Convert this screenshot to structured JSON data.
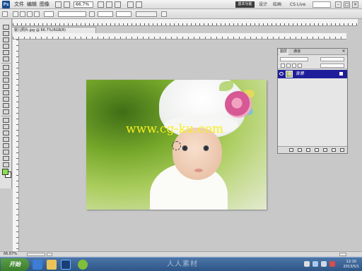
{
  "menu": {
    "app_icon": "Ps",
    "left_items": [
      "文件",
      "编辑",
      "图像"
    ],
    "zoom_value": "66.7%",
    "workspace_label": "基本功能",
    "right_items": [
      "设计",
      "绘画",
      "CS Live"
    ]
  },
  "document": {
    "tab_title": "婴儿照片.jpg @ 66.7%(RGB/8)"
  },
  "canvas": {
    "watermark_text": "www.cg-ku.com"
  },
  "layers_panel": {
    "tabs": [
      "图层",
      "通道"
    ],
    "layer_name": "背景",
    "close_symbol": "×"
  },
  "status": {
    "zoom": "66.67%"
  },
  "taskbar": {
    "start_label": "开始",
    "overlay_text": "人人素材",
    "clock_time": "12:10",
    "clock_date": "2013/5/1"
  },
  "colors": {
    "foreground": "#88e24e",
    "background": "#ffffff",
    "layer_selection": "#1f1e9a",
    "watermark": "#f6f01a"
  },
  "icons": {
    "toolbox": [
      "move-icon",
      "marquee-icon",
      "lasso-icon",
      "quick-select-icon",
      "crop-icon",
      "eyedropper-icon",
      "healing-icon",
      "brush-icon",
      "clone-stamp-icon",
      "history-brush-icon",
      "eraser-icon",
      "gradient-icon",
      "blur-icon",
      "dodge-icon",
      "pen-icon",
      "type-icon",
      "path-select-icon",
      "shape-icon",
      "3d-rotate-icon",
      "3d-orbit-icon",
      "hand-icon",
      "zoom-icon"
    ]
  }
}
